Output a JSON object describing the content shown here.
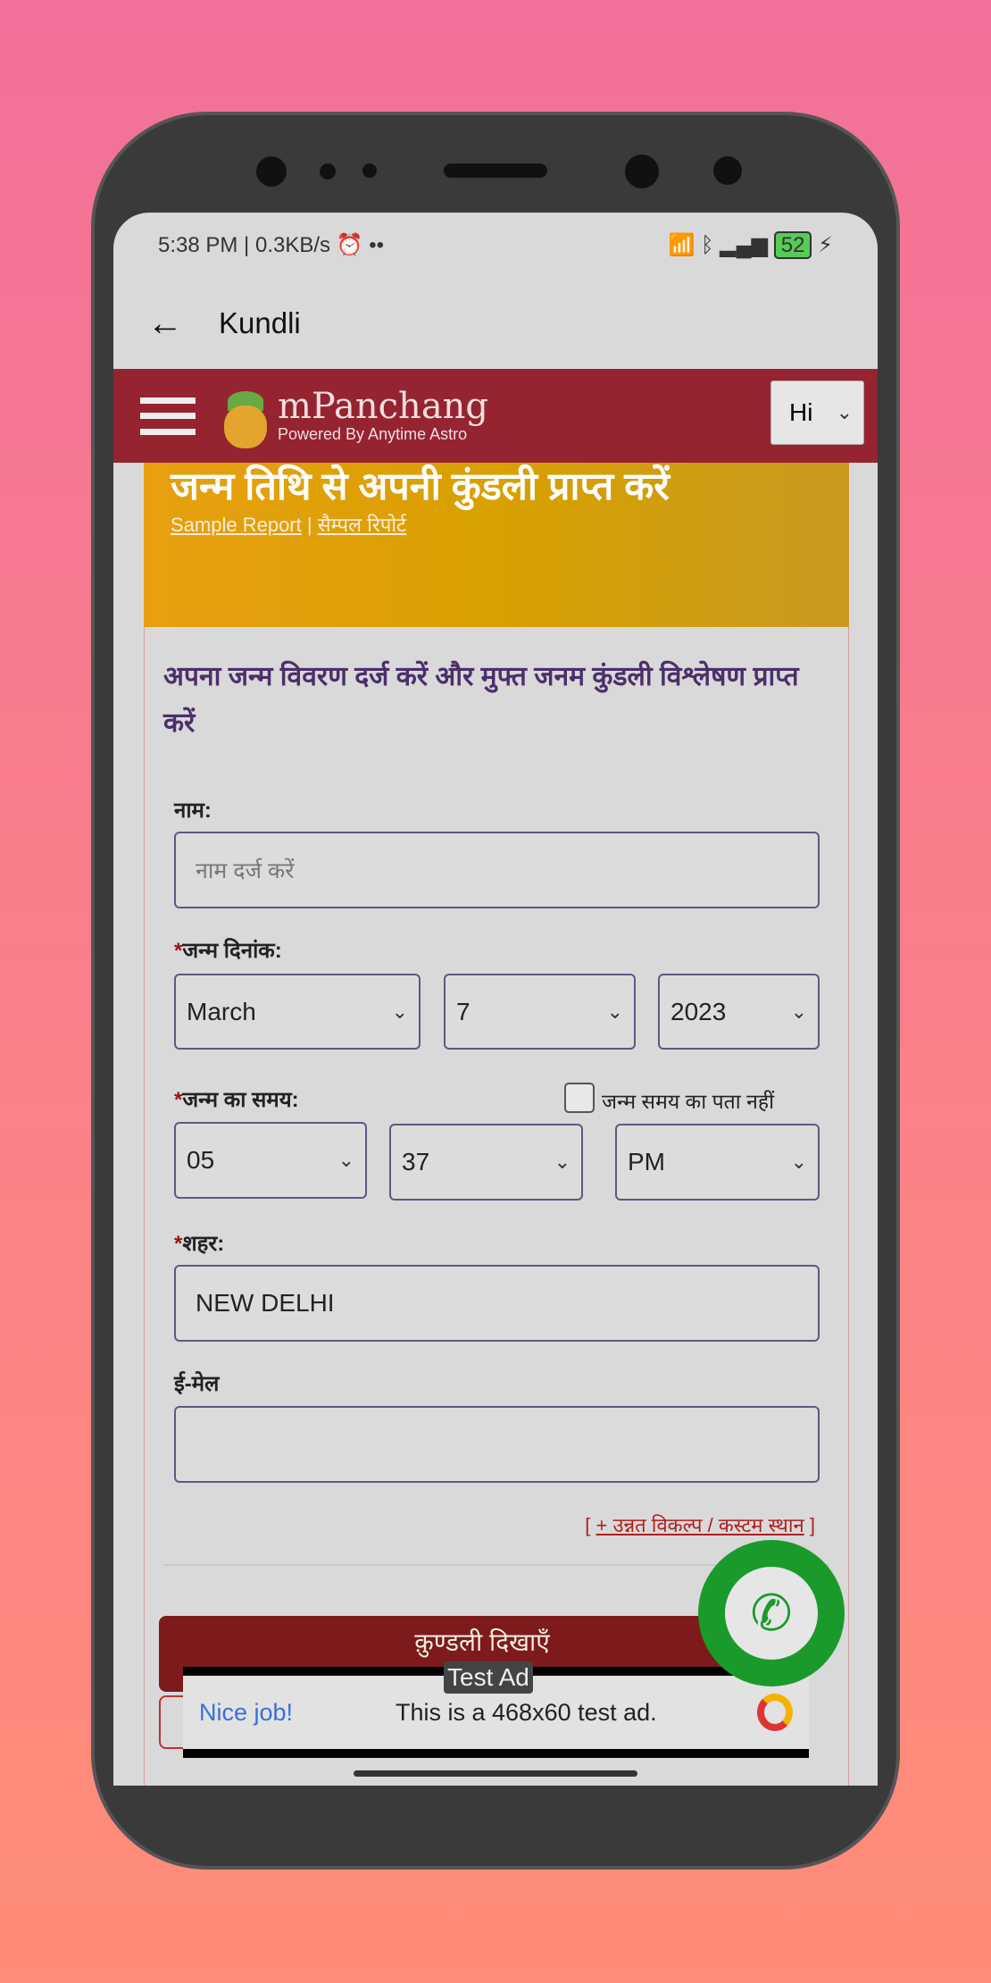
{
  "status_bar": {
    "time": "5:38 PM",
    "speed": "0.3KB/s",
    "battery": "52"
  },
  "appbar": {
    "title": "Kundli"
  },
  "header": {
    "brand": "mPanchang",
    "tagline": "Powered By Anytime Astro",
    "language": "Hi"
  },
  "banner": {
    "title": "जन्म तिथि से अपनी कुंडली प्राप्त करें",
    "sample_report": "Sample Report",
    "separator": "|",
    "sample_report_hi": "सैम्पल रिपोर्ट"
  },
  "form": {
    "lead": "अपना जन्म विवरण दर्ज करें और मुफ्त जनम कुंडली विश्लेषण प्राप्त करें",
    "name_label": "नाम:",
    "name_placeholder": "नाम दर्ज करें",
    "required_mark": "*",
    "dob_label": "जन्म दिनांक:",
    "month": "March",
    "day": "7",
    "year": "2023",
    "tob_label": "जन्म का समय:",
    "unknown_time_label": "जन्म समय का पता नहीं",
    "unknown_time_checked": false,
    "hour": "05",
    "minute": "37",
    "ampm": "PM",
    "city_label": "शहर:",
    "city": "NEW DELHI",
    "email_label": "ई-मेल",
    "email": "",
    "advanced_open": "[",
    "advanced_link": "+ उन्नत विकल्प / कस्टम स्थान",
    "advanced_close": "]",
    "submit": "क़ुण्डली दिखाएँ"
  },
  "ad": {
    "badge": "Test Ad",
    "headline": "Nice job!",
    "text": "This is a 468x60 test ad."
  },
  "colors": {
    "header": "#962330",
    "submit": "#7d1a1c",
    "fab": "#1a9a2a",
    "lead": "#4c2f6a"
  }
}
